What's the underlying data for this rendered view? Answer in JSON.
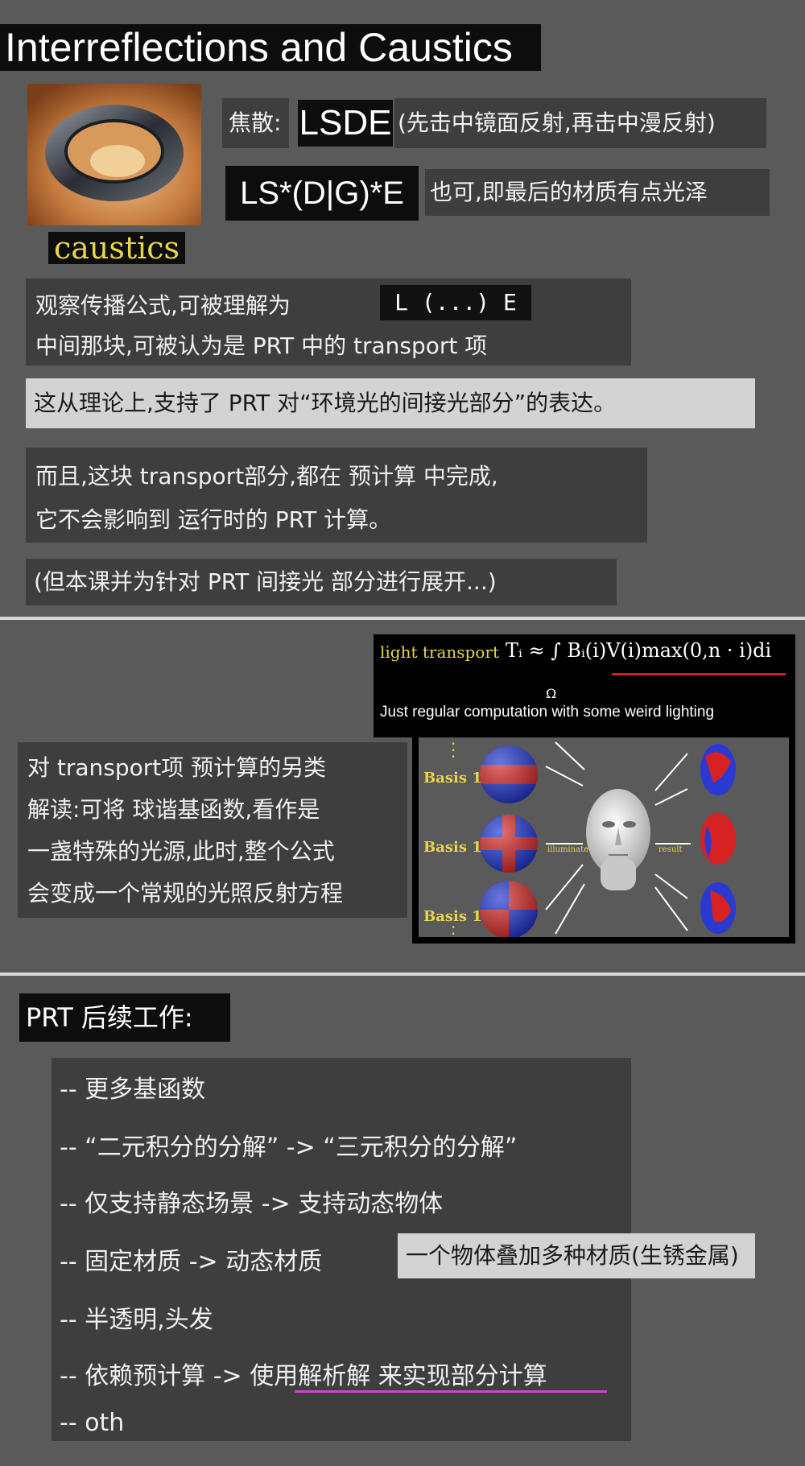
{
  "title": "Interreflections and Caustics",
  "caustics_label": "caustics",
  "row1": {
    "label": "焦散:",
    "code": "LSDE",
    "note": "(先击中镜面反射,再击中漫反射)"
  },
  "row2": {
    "code": "LS*(D|G)*E",
    "note": "也可,即最后的材质有点光泽"
  },
  "box2": {
    "line1": "观察传播公式,可被理解为",
    "code": "L (...) E",
    "line2": "中间那块,可被认为是 PRT 中的 transport 项"
  },
  "box3": "这从理论上,支持了 PRT 对“环境光的间接光部分”的表达。",
  "box4": {
    "line1": "而且,这块 transport部分,都在 预计算 中完成,",
    "line2": "它不会影响到 运行时的 PRT 计算。"
  },
  "box5": "(但本课并为针对 PRT 间接光 部分进行展开...)",
  "formula": {
    "label": "light transport",
    "equation": "Tᵢ ≈ ∫ Bᵢ(i)V(i)max(0,n · i)di",
    "domain": "Ω",
    "bullet": "Just regular computation with some weird lighting"
  },
  "box6": {
    "line1": "对 transport项 预计算的另类",
    "line2": "解读:可将 球谐基函数,看作是",
    "line3": "一盏特殊的光源,此时,整个公式",
    "line4": "会变成一个常规的光照反射方程"
  },
  "figure": {
    "basis16": "Basis 16",
    "basis17": "Basis 17",
    "basis18": "Basis 18",
    "illuminate": "illuminate",
    "result": "result"
  },
  "prt_title": "PRT 后续工作:",
  "followups": [
    "-- 更多基函数",
    "-- “二元积分的分解” -> “三元积分的分解”",
    "-- 仅支持静态场景 -> 支持动态物体",
    "-- 固定材质 -> 动态材质",
    "-- 半透明,头发",
    "-- 依赖预计算 -> 使用解析解 来实现部分计算",
    "-- oth"
  ],
  "followup_highlight": "一个物体叠加多种材质(生锈金属)",
  "colors": {
    "background": "#5a5a5a",
    "panel": "#3e3e3e",
    "highlight": "#d3d3d3",
    "gold": "#e8d64a",
    "red": "#cc2222",
    "blue": "#1a2ecc",
    "pink": "#d63fd6"
  }
}
